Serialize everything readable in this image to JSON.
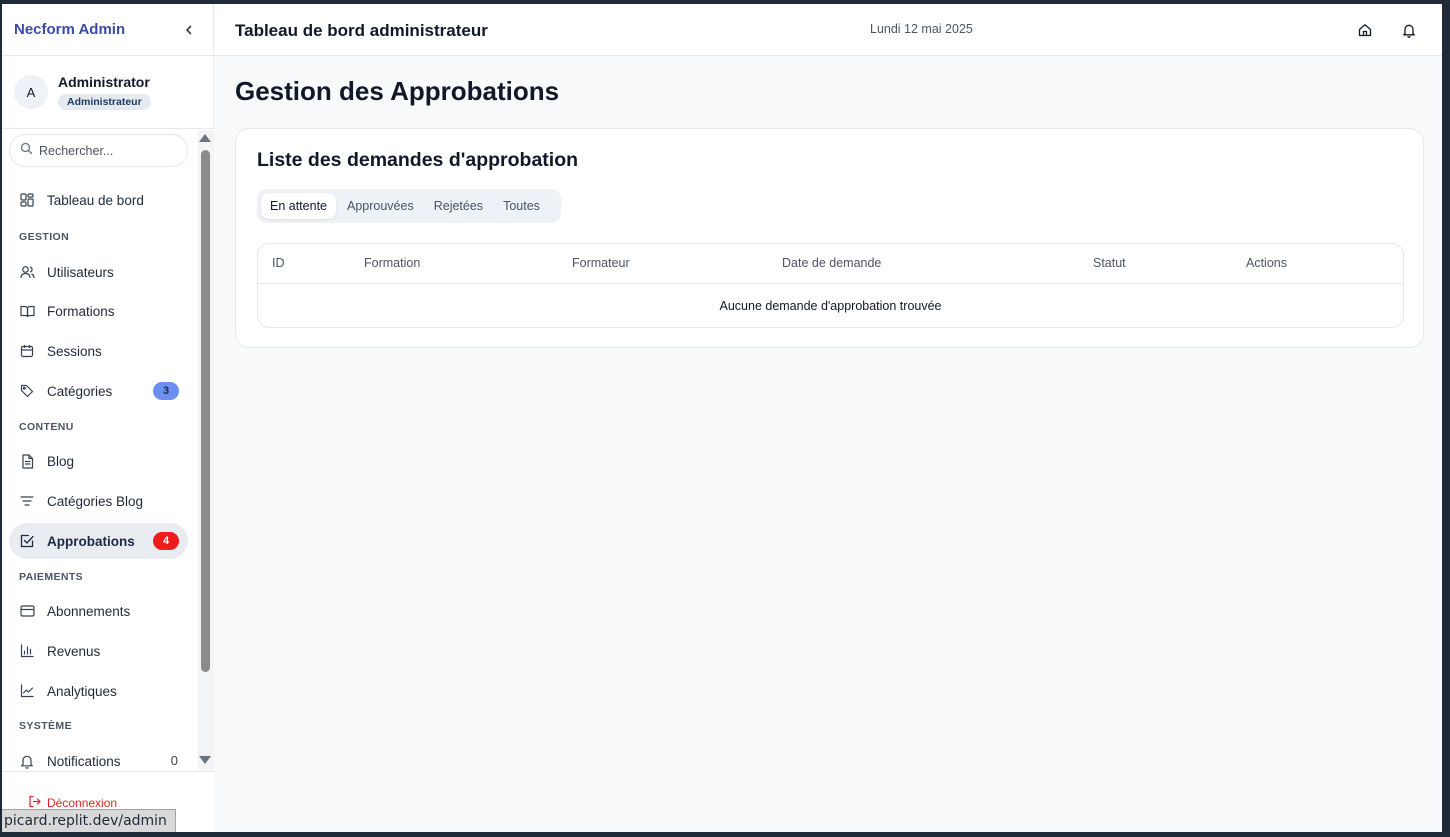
{
  "sidebar": {
    "brand": "Necform Admin",
    "user": {
      "initial": "A",
      "name": "Administrator",
      "role": "Administrateur"
    },
    "search": {
      "placeholder": "Rechercher..."
    },
    "dashboard_label": "Tableau de bord",
    "sections": {
      "gestion": "GESTION",
      "contenu": "CONTENU",
      "paiements": "PAIEMENTS",
      "systeme": "SYSTÈME"
    },
    "items": {
      "utilisateurs": "Utilisateurs",
      "formations": "Formations",
      "sessions": "Sessions",
      "categories": {
        "label": "Catégories",
        "badge": "3"
      },
      "blog": "Blog",
      "categories_blog": "Catégories Blog",
      "approbations": {
        "label": "Approbations",
        "badge": "4"
      },
      "abonnements": "Abonnements",
      "revenus": "Revenus",
      "analytiques": "Analytiques",
      "notifications": {
        "label": "Notifications",
        "count": "0"
      }
    },
    "logout": "Déconnexion"
  },
  "status_url": "picard.replit.dev/admin",
  "header": {
    "title": "Tableau de bord administrateur",
    "date": "Lundi 12 mai 2025"
  },
  "main": {
    "page_title": "Gestion des Approbations",
    "card_title": "Liste des demandes d'approbation",
    "tabs": [
      "En attente",
      "Approuvées",
      "Rejetées",
      "Toutes"
    ],
    "columns": [
      "ID",
      "Formation",
      "Formateur",
      "Date de demande",
      "Statut",
      "Actions"
    ],
    "empty_message": "Aucune demande d'approbation trouvée"
  },
  "colors": {
    "brand": "#3b4aa8",
    "badge_blue": "#6b8ff5",
    "badge_red": "#ee1c1c",
    "logout": "#dc2626"
  }
}
